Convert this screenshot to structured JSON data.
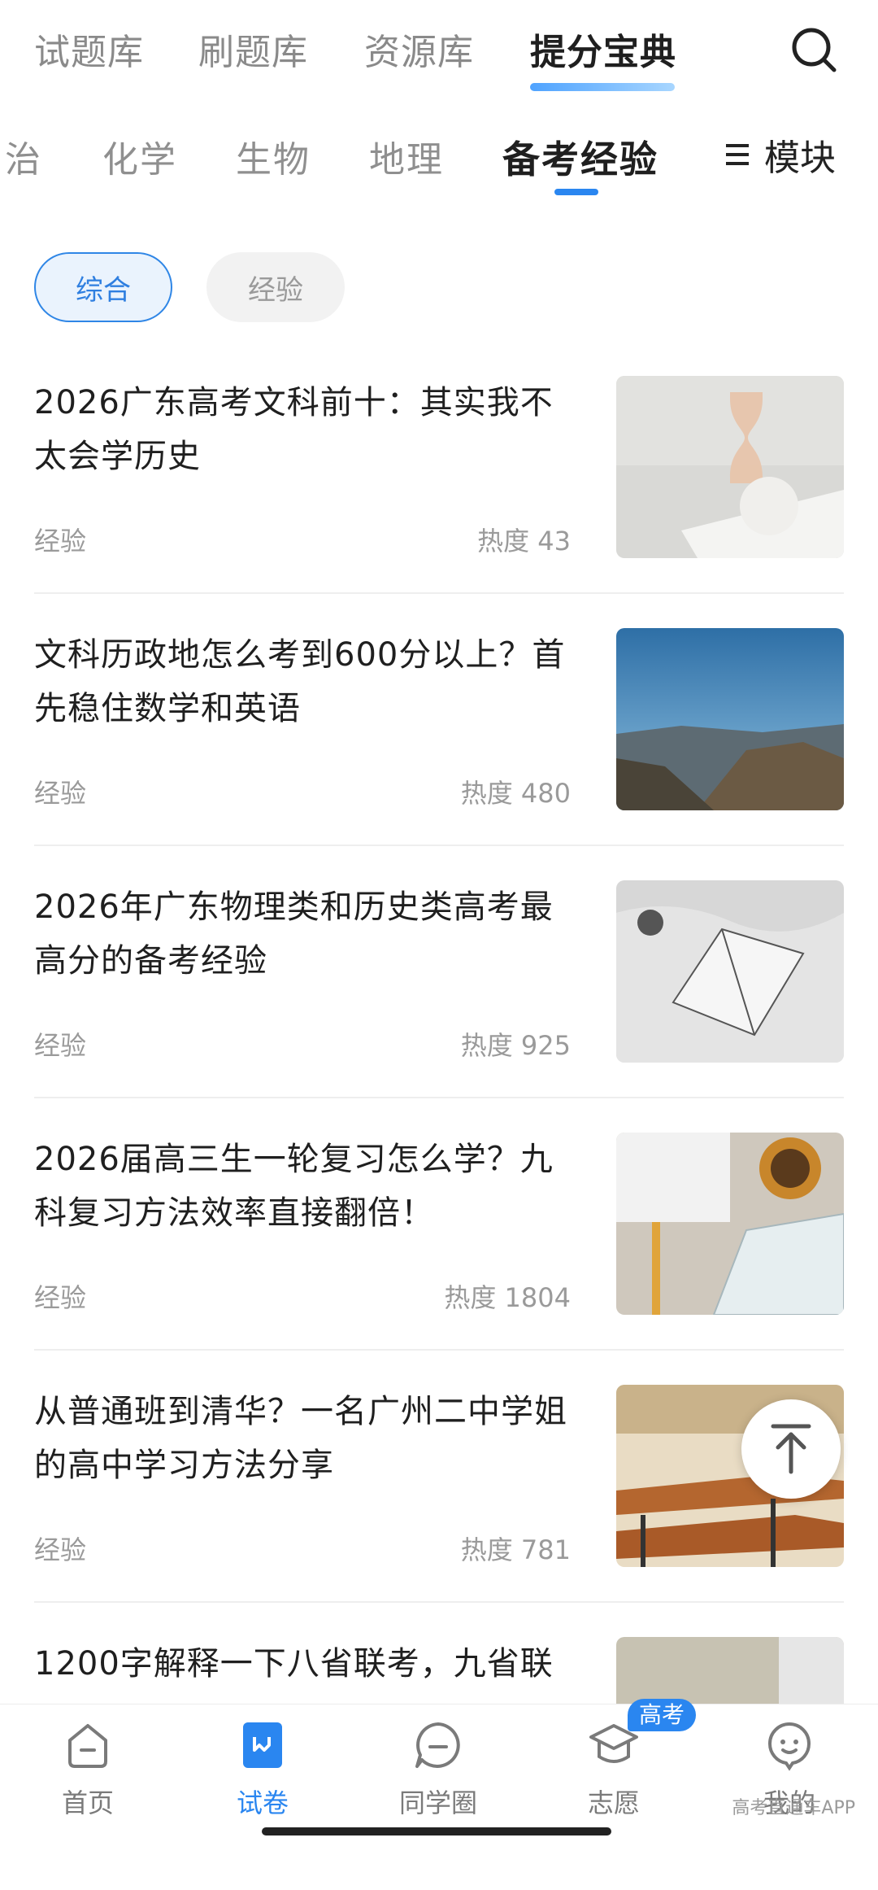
{
  "top_tabs": [
    "试题库",
    "刷题库",
    "资源库",
    "提分宝典"
  ],
  "subject_tabs": [
    "治",
    "化学",
    "生物",
    "地理",
    "备考经验"
  ],
  "module_label": "模块",
  "filters": [
    "综合",
    "经验"
  ],
  "articles": [
    {
      "title": "2026广东高考文科前十：其实我不太会学历史",
      "tag": "经验",
      "heat": "热度 43"
    },
    {
      "title": "文科历政地怎么考到600分以上？首先稳住数学和英语",
      "tag": "经验",
      "heat": "热度 480"
    },
    {
      "title": "2026年广东物理类和历史类高考最高分的备考经验",
      "tag": "经验",
      "heat": "热度 925"
    },
    {
      "title": "2026届高三生一轮复习怎么学？九科复习方法效率直接翻倍！",
      "tag": "经验",
      "heat": "热度 1804"
    },
    {
      "title": "从普通班到清华？一名广州二中学姐的高中学习方法分享",
      "tag": "经验",
      "heat": "热度 781"
    },
    {
      "title": "1200字解释一下八省联考，九省联"
    }
  ],
  "bottom_nav": [
    {
      "label": "首页"
    },
    {
      "label": "试卷"
    },
    {
      "label": "同学圈"
    },
    {
      "label": "志愿"
    },
    {
      "label": "我的"
    }
  ],
  "badge": "高考",
  "watermark": "高考直通车APP",
  "colors": {
    "accent": "#2a86f0",
    "text": "#1f1f1f",
    "muted": "#9a9a9a"
  }
}
